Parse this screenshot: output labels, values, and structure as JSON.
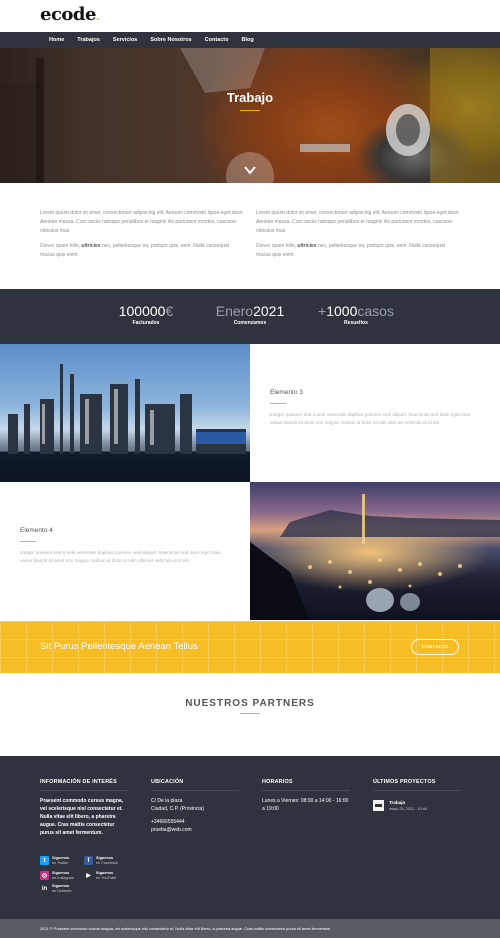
{
  "header": {
    "logo": "ecode",
    "logo_mark": "."
  },
  "nav": {
    "items": [
      "Home",
      "Trabajos",
      "Servicios",
      "Sobre Nosotros",
      "Contacto",
      "Blog"
    ]
  },
  "hero": {
    "title": "Trabajo"
  },
  "intro": {
    "col1_p1": "Lorem ipsum dolor sit amet, consectetuer adipiscing elit. Aenean commodo ligula eget dolor. Aenean massa. Cum sociis natoque penatibus et magnis dis parturient montes, nascetur ridiculus mus.",
    "col1_p2_pre": "Donec quam felis, ",
    "col1_p2_bold": "ultricies",
    "col1_p2_post": " nec, pellentesque eu, pretium quis, sem. Nulla consequat massa quis enim.",
    "col2_p1": "Lorem ipsum dolor sit amet, consectetuer adipiscing elit. Aenean commodo ligula eget dolor. Aenean massa. Cum sociis natoque penatibus et magnis dis parturient montes, nascetur ridiculus mus.",
    "col2_p2_pre": "Donec quam felis, ",
    "col2_p2_bold": "ultricies",
    "col2_p2_post": " nec, pellentesque eu, pretium quis, sem. Nulla consequat massa quis enim."
  },
  "stats": [
    {
      "value": "100000",
      "unit": "€",
      "label": "Facturados"
    },
    {
      "prefix": "Enero",
      "value": "2021",
      "label": "Comenzamos"
    },
    {
      "prefix": "+",
      "value": "1000",
      "unit": "casos",
      "label": "Resueltos"
    }
  ],
  "features": {
    "item3": {
      "title": "Elemento 3",
      "body": "Integer posuere erat a ante venenatis dapibus posuere velit aliquet. Maecenas sed diam eget risus varius blandit sit amet non magna. Nullam id dolor id nibh ultricies vehicula ut id elit."
    },
    "item4": {
      "title": "Elemento 4",
      "body": "Integer posuere erat a ante venenatis dapibus posuere velit aliquet. Maecenas sed diam eget risus varius blandit sit amet non magna. Nullam id dolor id nibh ultricies vehicula ut id elit."
    }
  },
  "cta": {
    "text": "Sit Purus Pellentesque Aenean Tellus",
    "button": "CONTACTO"
  },
  "partners": {
    "title": "NUESTROS PARTNERS"
  },
  "footer": {
    "info": {
      "title": "INFORMACIÓN DE INTERÉS",
      "body": "Praesent commodo cursus magna, vel scelerisque nisl consectetur et. Nulla vitae elit libero, a pharetra augue. Cras mattis consectetur purus sit amet fermentum."
    },
    "ubicacion": {
      "title": "UBICACIÓN",
      "line1": "C/ De la plaza",
      "line2": "Ciudad, C.P. (Provincia)",
      "phone": "+34666555444",
      "email": "prueba@web.com"
    },
    "horarios": {
      "title": "HORARIOS",
      "body": "Lunes a Viernes: 08:00 a 14:00 - 16:00 a 19:00"
    },
    "proyectos": {
      "title": "ÚLTIMOS PROYECTOS",
      "item_title": "Trabajo",
      "item_date": "mayo 25, 2021 - 10:44"
    },
    "social": [
      {
        "top": "Síguenos",
        "bottom": "en Twitter",
        "icon": "twitter-icon",
        "color": "#1da1f2"
      },
      {
        "top": "Síguenos",
        "bottom": "en Facebook",
        "icon": "facebook-icon",
        "color": "#3b5998"
      },
      {
        "top": "Síguenos",
        "bottom": "en Instagram",
        "icon": "instagram-icon",
        "color": "#c13584"
      },
      {
        "top": "Síguenos",
        "bottom": "en YouTube",
        "icon": "youtube-icon",
        "color": "#2e333d"
      },
      {
        "top": "Síguenos",
        "bottom": "en LinkedIn",
        "icon": "linkedin-icon",
        "color": "#2e333d"
      }
    ]
  },
  "copyright": {
    "text": "2021 © Praesent commodo cursus magna, vel scelerisque nisl consectetur et. Nulla vitae elit libero, a pharetra augue. Cras mattis consectetur purus sit amet fermentum."
  },
  "colors": {
    "accent": "#f6bd24",
    "dark": "#2e333d",
    "gold_line": "#f0b400"
  }
}
